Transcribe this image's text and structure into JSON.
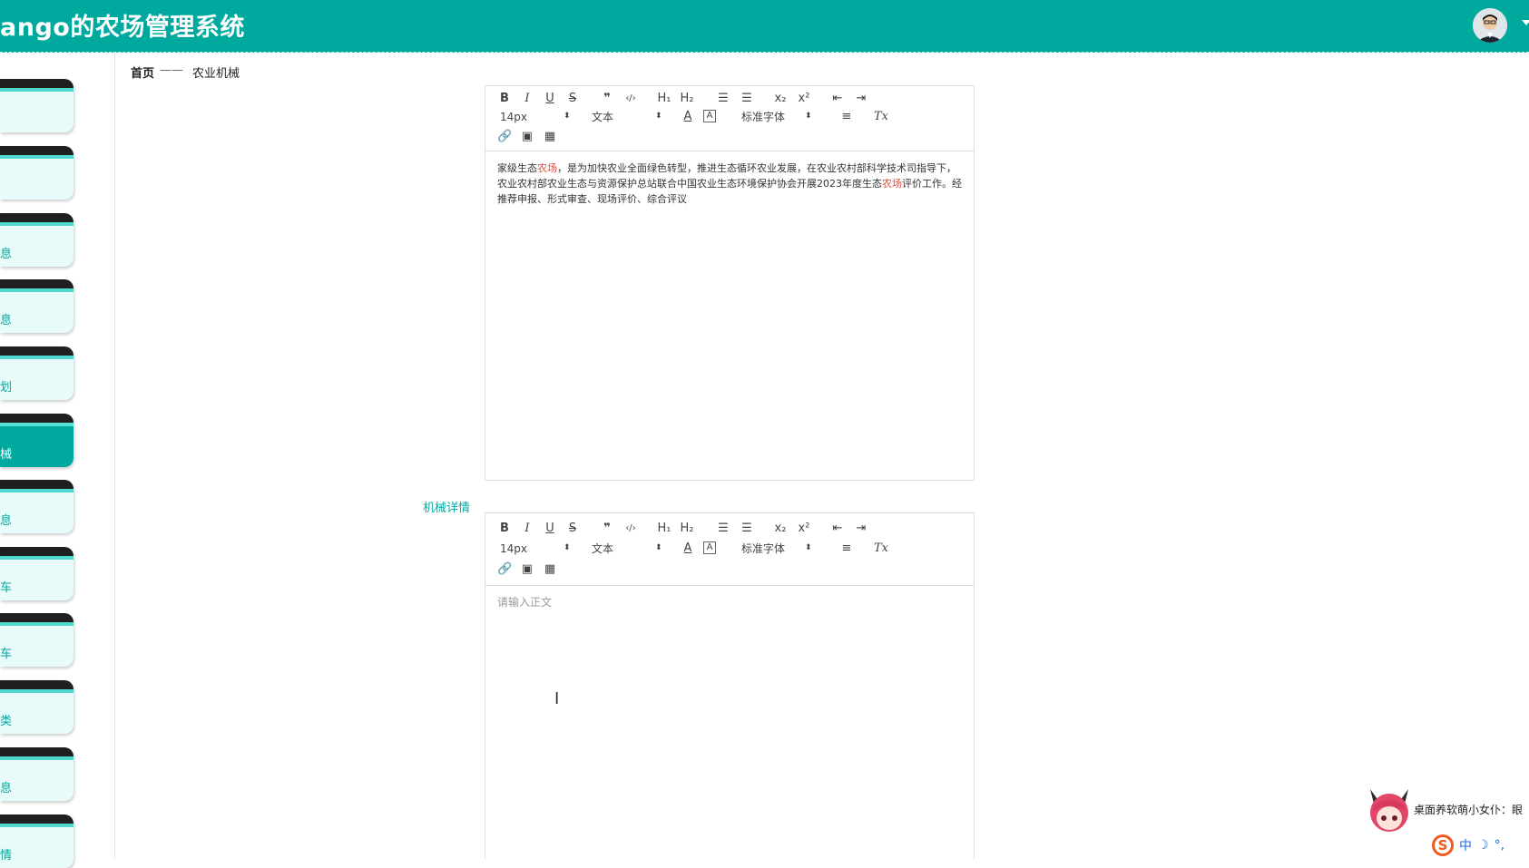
{
  "header": {
    "title": "ango的农场管理系统",
    "colors": {
      "bar": "#00a99d",
      "text": "#ffffff"
    }
  },
  "sidebar": {
    "items": [
      {
        "label": ""
      },
      {
        "label": ""
      },
      {
        "label": "息"
      },
      {
        "label": "息"
      },
      {
        "label": "划"
      },
      {
        "label": "械",
        "active": true
      },
      {
        "label": "息"
      },
      {
        "label": "车"
      },
      {
        "label": "车"
      },
      {
        "label": "类"
      },
      {
        "label": "息"
      },
      {
        "label": "情"
      }
    ],
    "colors": {
      "item_bg": "#e6fbfa",
      "active_bg": "#00a99d",
      "cap": "#1f1f1f"
    }
  },
  "breadcrumb": {
    "home": "首页",
    "separator": "——",
    "current": "农业机械"
  },
  "toolbar": {
    "bold": "B",
    "italic": "I",
    "underline": "U",
    "strike": "S",
    "quote": "❞",
    "code": "‹/›",
    "h1": "H₁",
    "h2": "H₂",
    "ordered_list": "☰",
    "bullet_list": "☰",
    "subscript": "x₂",
    "superscript": "x²",
    "outdent": "⇤",
    "indent": "⇥",
    "size": "14px",
    "header_select": "文本",
    "font_color": "A",
    "background": "A",
    "font_family": "标准字体",
    "align": "≡",
    "clean": "Tx",
    "link": "🔗",
    "image": "▣",
    "video": "▦"
  },
  "editor1": {
    "segments": [
      {
        "text": "家级生态",
        "red": false
      },
      {
        "text": "农场",
        "red": true
      },
      {
        "text": "，是为加快农业全面绿色转型，推进生态循环农业发展，在农业农村部科学技术司指导下，农业农村部农业生态与资源保护总站联合中国农业生态环境保护协会开展2023年度生态",
        "red": false
      },
      {
        "text": "农场",
        "red": true
      },
      {
        "text": "评价工作。经推荐申报、形式审查、现场评价、综合评议",
        "red": false
      }
    ]
  },
  "editor2": {
    "label": "机械详情",
    "placeholder": "请输入正文"
  },
  "overlay": {
    "mascot_text": "桌面养软萌小女仆：眼",
    "ime_logo": "S",
    "ime_lang": "中",
    "ime_moon": "☽",
    "ime_punct": "°,"
  }
}
